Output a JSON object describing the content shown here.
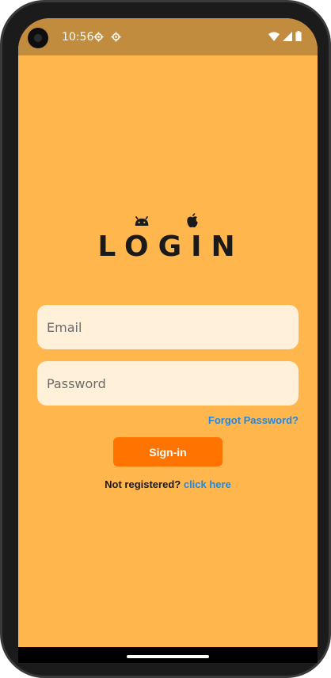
{
  "status_bar": {
    "time": "10:56",
    "left_icons": [
      "settings-gear-icon",
      "settings-gear-icon"
    ],
    "right_icons": [
      "wifi-icon",
      "signal-icon",
      "battery-icon"
    ]
  },
  "colors": {
    "background": "#ffb74d",
    "status_bar": "#c28c3f",
    "field_bg": "#fff0da",
    "primary_button": "#ff7300",
    "link": "#1e88e5"
  },
  "logo": {
    "icons": [
      "android-icon",
      "apple-icon"
    ],
    "title": "LOGIN"
  },
  "form": {
    "email_placeholder": "Email",
    "password_placeholder": "Password",
    "forgot_label": "Forgot Password?",
    "signin_label": "Sign-in",
    "register_prompt": "Not registered?",
    "register_link": "click here"
  }
}
